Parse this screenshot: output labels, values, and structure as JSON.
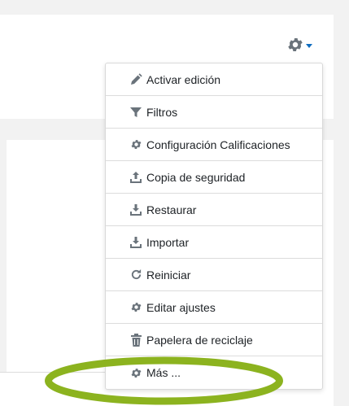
{
  "settings": {
    "icon": "gear-icon",
    "caret_icon": "caret-down-icon",
    "accent": "#0f6cbf",
    "icon_color": "#6a737b"
  },
  "menu": {
    "items": [
      {
        "label": "Activar edición",
        "icon": "pencil-icon"
      },
      {
        "label": "Filtros",
        "icon": "filter-icon"
      },
      {
        "label": "Configuración Calificaciones",
        "icon": "gear-icon"
      },
      {
        "label": "Copia de seguridad",
        "icon": "upload-icon"
      },
      {
        "label": "Restaurar",
        "icon": "download-icon"
      },
      {
        "label": "Importar",
        "icon": "download-icon"
      },
      {
        "label": "Reiniciar",
        "icon": "refresh-icon"
      },
      {
        "label": "Editar ajustes",
        "icon": "gear-icon"
      },
      {
        "label": "Papelera de reciclaje",
        "icon": "trash-icon"
      },
      {
        "label": "Más ...",
        "icon": "gear-icon"
      }
    ]
  },
  "annotation": {
    "highlight_color": "#8cb31f",
    "target": "Más ..."
  }
}
